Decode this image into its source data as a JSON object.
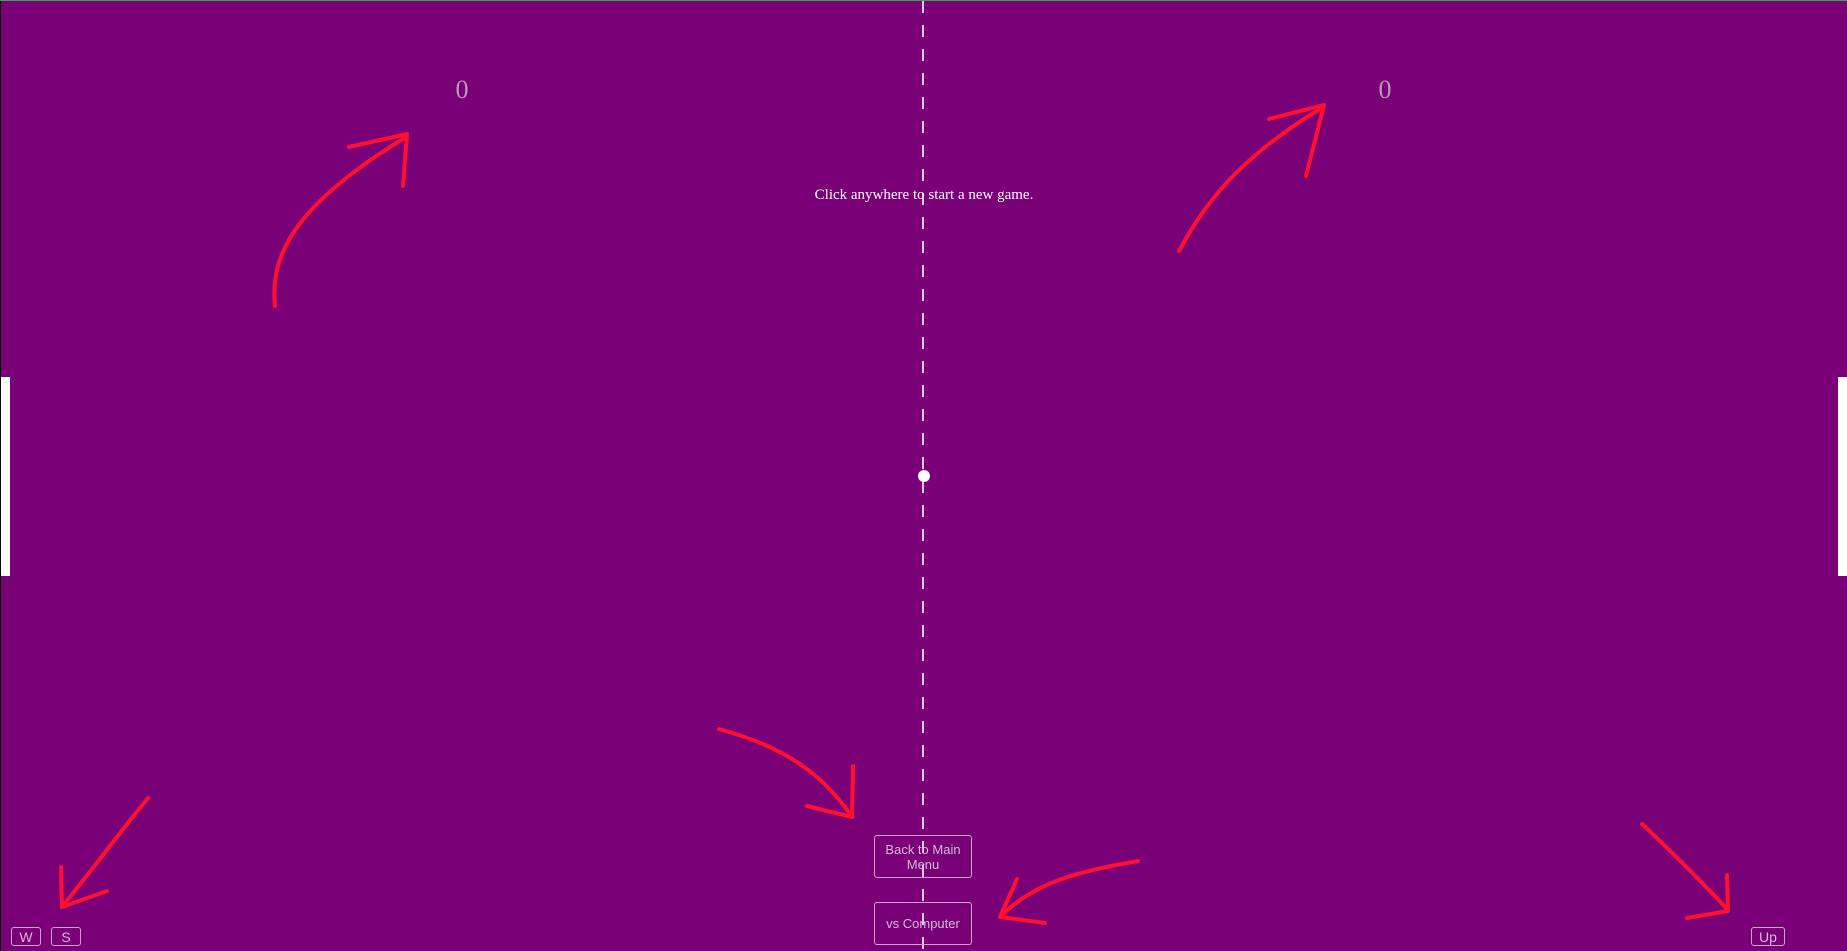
{
  "scores": {
    "left": "0",
    "right": "0"
  },
  "message": "Click anywhere to start a new game.",
  "buttons": {
    "back": "Back to Main Menu",
    "mode": "vs Computer"
  },
  "keys": {
    "left_up": "W",
    "left_down": "S",
    "right_up": "Up"
  },
  "colors": {
    "field": "#7a0077",
    "net": "#d7b8d6",
    "paddle": "#ffffff",
    "ball": "#ffffff",
    "annotation_arrows": "#ff1030"
  },
  "annotations": [
    "arrow-to-left-score",
    "arrow-to-right-score",
    "arrow-to-back-button",
    "arrow-to-mode-button",
    "arrow-to-left-keys",
    "arrow-to-right-key"
  ]
}
